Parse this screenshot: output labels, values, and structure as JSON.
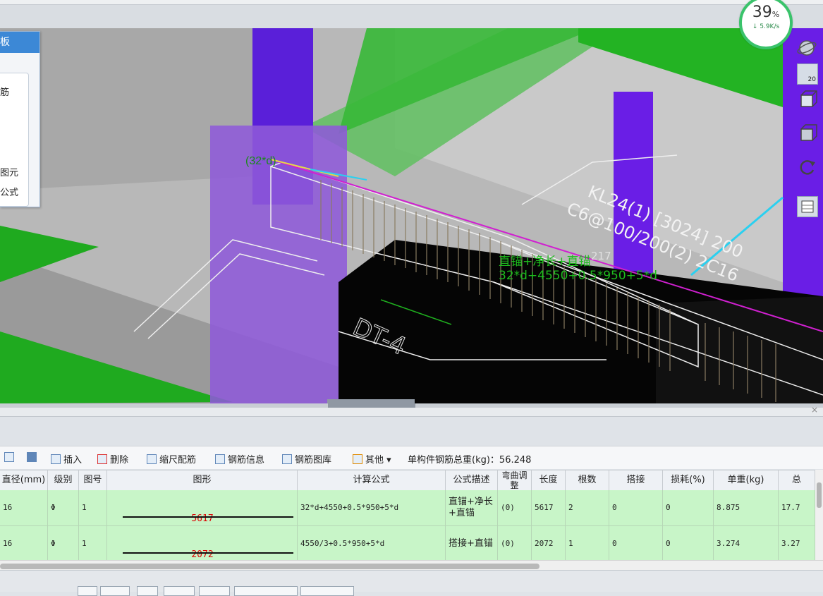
{
  "panel": {
    "title": "板",
    "items": [
      "筋",
      "图元",
      "公式"
    ]
  },
  "net": {
    "percent": "39",
    "percent_unit": "%",
    "speed": "5.9K/s"
  },
  "right_tools": {
    "zoom_badge": "20"
  },
  "viewport_labels": {
    "bracket": "(32*d)",
    "beam_name": "KL24(1) [3024] 200",
    "beam_spec": "C6@100/200(2) 2C16",
    "anchor_desc": "直锚+净长+直锚",
    "anchor_formula": "32*d+4550+0.5*950+5*d",
    "dt": "DT-4",
    "value_217": "217"
  },
  "toolbar": {
    "insert": "插入",
    "delete": "删除",
    "scale": "缩尺配筋",
    "info": "钢筋信息",
    "library": "钢筋图库",
    "other": "其他",
    "total": "单构件钢筋总重(kg)：56.248"
  },
  "table": {
    "headers": [
      "直径(mm)",
      "级别",
      "图号",
      "图形",
      "计算公式",
      "公式描述",
      "弯曲调整",
      "长度",
      "根数",
      "搭接",
      "损耗(%)",
      "单重(kg)",
      "总"
    ],
    "rows": [
      {
        "diameter": "16",
        "grade": "Φ",
        "fig": "1",
        "shape": "5617",
        "formula": "32*d+4550+0.5*950+5*d",
        "desc": "直锚+净长+直锚",
        "bend": "(0)",
        "length": "5617",
        "count": "2",
        "lap": "0",
        "loss": "0",
        "unit": "8.875",
        "total": "17.7"
      },
      {
        "diameter": "16",
        "grade": "Φ",
        "fig": "1",
        "shape": "2072",
        "formula": "4550/3+0.5*950+5*d",
        "desc": "搭接+直锚",
        "bend": "(0)",
        "length": "2072",
        "count": "1",
        "lap": "0",
        "loss": "0",
        "unit": "3.274",
        "total": "3.27"
      }
    ]
  },
  "colors": {
    "purple": "#5a1fd9",
    "green": "#2bb52b",
    "panel_title": "#3c88d6",
    "row_bg": "#c8f5c8"
  }
}
